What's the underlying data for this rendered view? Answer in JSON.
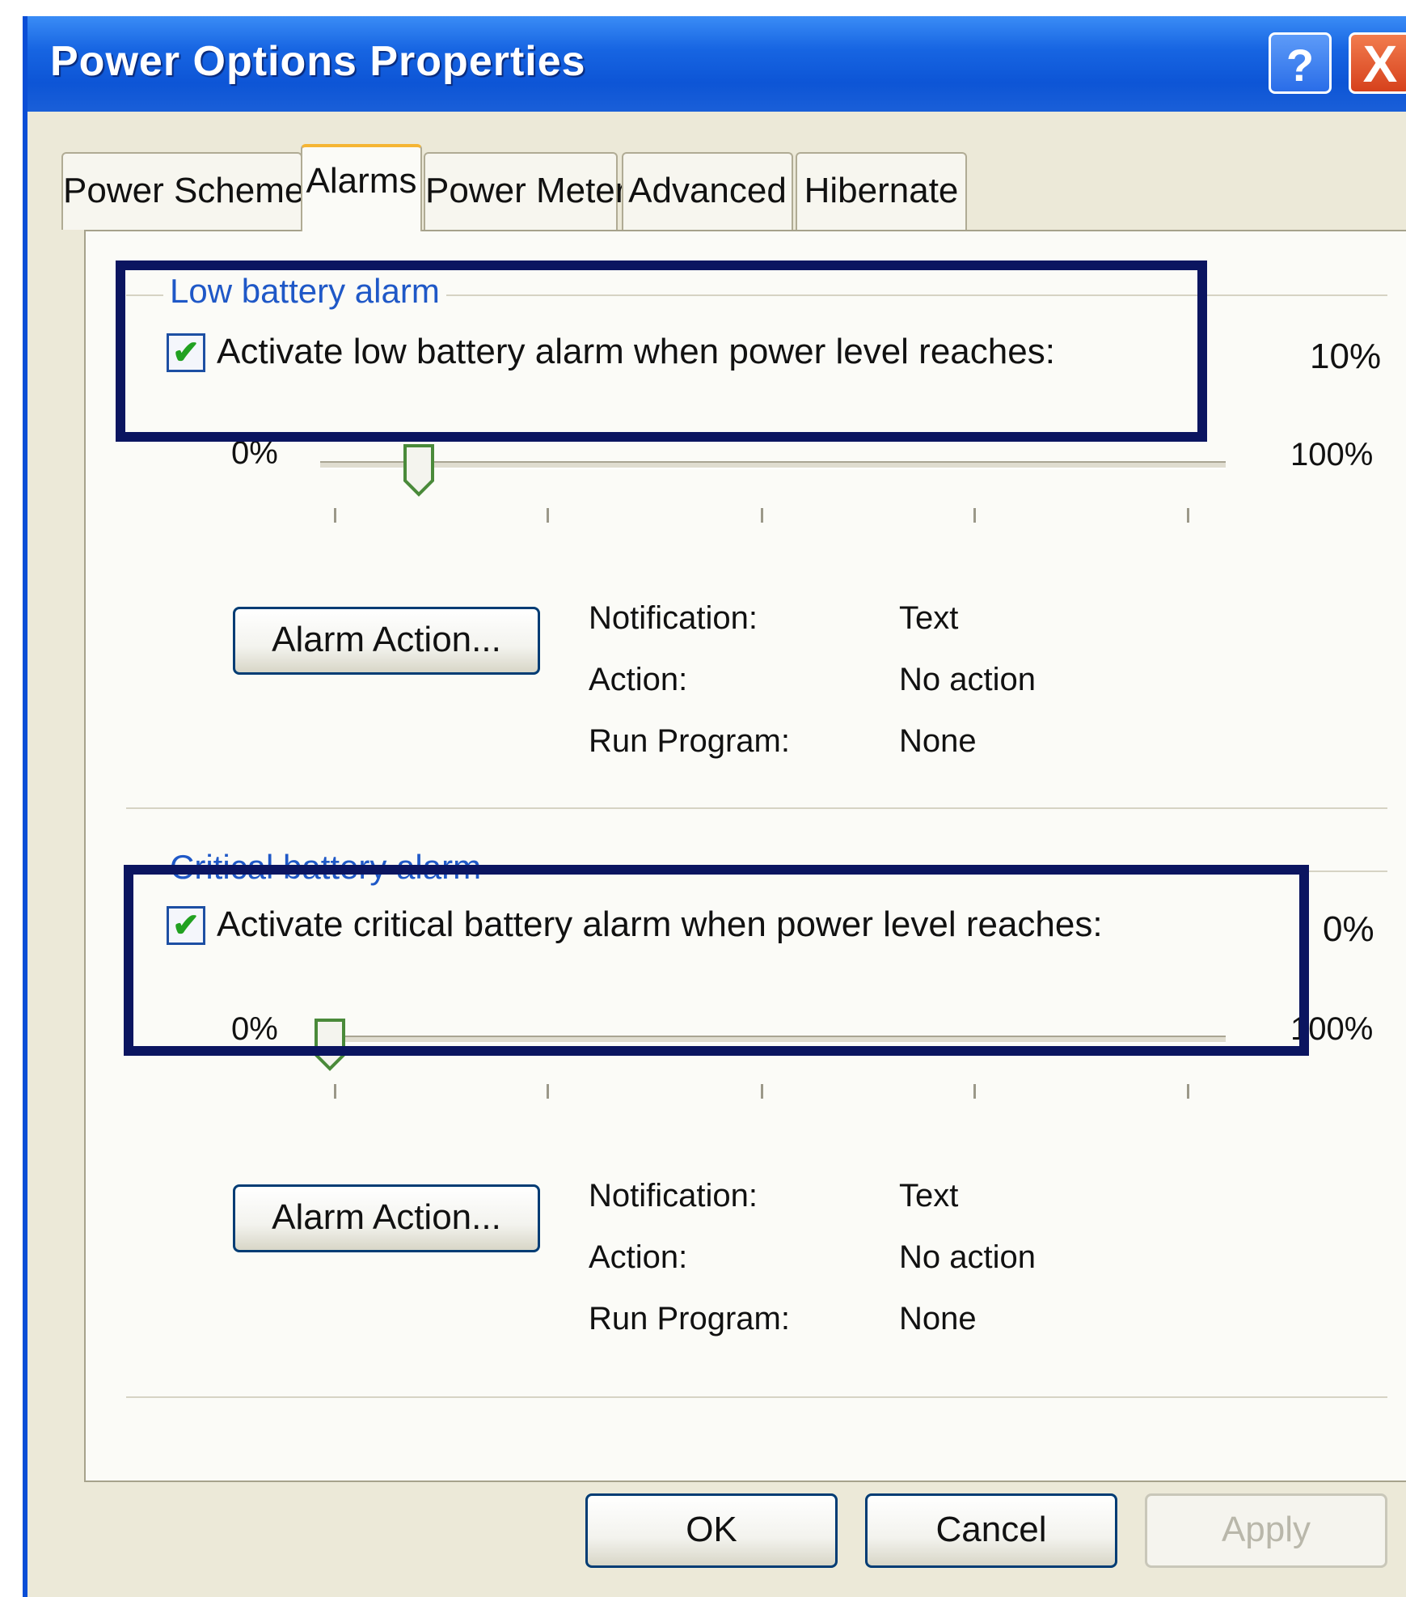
{
  "window": {
    "title": "Power Options Properties",
    "help_label": "?",
    "close_label": "X"
  },
  "tabs": [
    {
      "label": "Power Schemes"
    },
    {
      "label": "Alarms"
    },
    {
      "label": "Power Meter"
    },
    {
      "label": "Advanced"
    },
    {
      "label": "Hibernate"
    }
  ],
  "low_alarm": {
    "group_title": "Low battery alarm",
    "checkbox_label": "Activate low battery alarm when power level reaches:",
    "checked": true,
    "level_value": "10%",
    "level": 10,
    "min_label": "0%",
    "max_label": "100%",
    "button_label": "Alarm Action...",
    "notification_label": "Notification:",
    "notification_value": "Text",
    "action_label": "Action:",
    "action_value": "No action",
    "program_label": "Run Program:",
    "program_value": "None"
  },
  "critical_alarm": {
    "group_title": "Critical battery alarm",
    "checkbox_label": "Activate critical battery alarm when power level reaches:",
    "checked": true,
    "level_value": "0%",
    "level": 0,
    "min_label": "0%",
    "max_label": "100%",
    "button_label": "Alarm Action...",
    "notification_label": "Notification:",
    "notification_value": "Text",
    "action_label": "Action:",
    "action_value": "No action",
    "program_label": "Run Program:",
    "program_value": "None"
  },
  "footer": {
    "ok_label": "OK",
    "cancel_label": "Cancel",
    "apply_label": "Apply"
  },
  "check_glyph": "✔",
  "colors": {
    "titlebar": "#0d55d6",
    "close": "#d6411c",
    "highlight_box": "#0b1560",
    "group_title": "#1f58c7"
  }
}
